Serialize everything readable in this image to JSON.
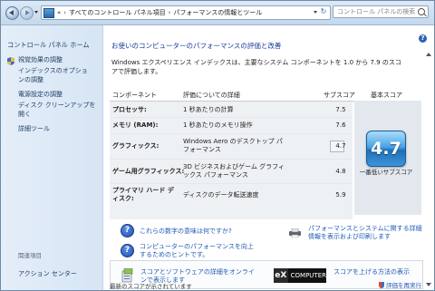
{
  "toolbar": {
    "address_prefix": "«",
    "crumbs": [
      "すべてのコントロール パネル項目",
      "パフォーマンスの情報とツール"
    ],
    "crumb_sep": "›",
    "search_placeholder": "コントロール パネルの検索"
  },
  "sidebar": {
    "home": "コントロール パネル ホーム",
    "items": [
      "視覚効果の調整",
      "インデックスのオプションの調整",
      "電源設定の調整",
      "ディスク クリーンアップを開く",
      "詳細ツール"
    ],
    "see_also": "関連項目",
    "action_center": "アクション センター"
  },
  "main": {
    "help_glyph": "?",
    "title": "お使いのコンピューターのパフォーマンスの評価と改善",
    "intro": "Windows エクスペリエンス インデックスは、主要なシステム コンポーネントを 1.0 から 7.9 のスコアで評価します。",
    "headers": {
      "component": "コンポーネント",
      "rating": "評価についての詳細",
      "subscore": "サブスコア",
      "base": "基本スコア"
    },
    "rows": [
      {
        "component": "プロセッサ:",
        "desc": "1 秒あたりの計算",
        "score": "7.5"
      },
      {
        "component": "メモリ (RAM):",
        "desc": "1 秒あたりのメモリ操作",
        "score": "7.6"
      },
      {
        "component": "グラフィックス:",
        "desc": "Windows Aero のデスクトップ パフォーマンス",
        "score": "4.7"
      },
      {
        "component": "ゲーム用グラフィックス:",
        "desc": "3D ビジネスおよびゲーム グラフィックス パフォーマンス",
        "score": "4.8"
      },
      {
        "component": "プライマリ ハード ディスク:",
        "desc": "ディスクのデータ転送速度",
        "score": "5.9"
      }
    ],
    "base_score": "4.7",
    "base_caption": "一番低いサブスコア",
    "links": {
      "meaning": "これらの数字の意味は何ですか?",
      "improve": "コンピューターのパフォーマンスを向上するためのヒントです。",
      "print": "パフォーマンスとシステムに関する詳細情報を表示および印刷します",
      "software": "スコアとソフトウェアの詳細をオンラインで表示します",
      "brand": "COMPUTER",
      "brand_mark": "eX",
      "raise": "スコアを上げる方法の表示"
    },
    "footer": "最新のスコアが示されています",
    "rerun": "評価を再実行"
  }
}
